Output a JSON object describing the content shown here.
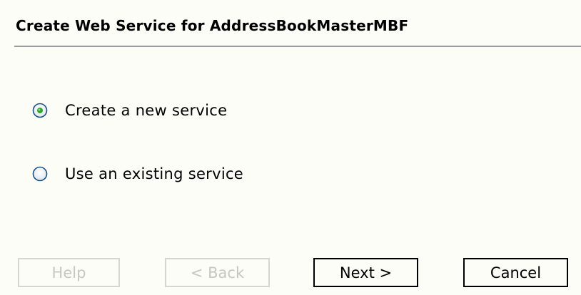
{
  "dialog": {
    "title": "Create Web Service for AddressBookMasterMBF"
  },
  "options": [
    {
      "label": "Create a new service",
      "selected": true
    },
    {
      "label": "Use an existing service",
      "selected": false
    }
  ],
  "buttons": {
    "help": {
      "label": "Help",
      "enabled": false
    },
    "back": {
      "label": "< Back",
      "enabled": false
    },
    "next": {
      "label": "Next >",
      "enabled": true
    },
    "cancel": {
      "label": "Cancel",
      "enabled": true
    }
  },
  "colors": {
    "background": "#fdfdf8",
    "radio_selected_dot": "#2fa52f",
    "radio_border": "#1c5180",
    "disabled_text": "#c7c7c0",
    "divider": "#9c9c9c"
  }
}
